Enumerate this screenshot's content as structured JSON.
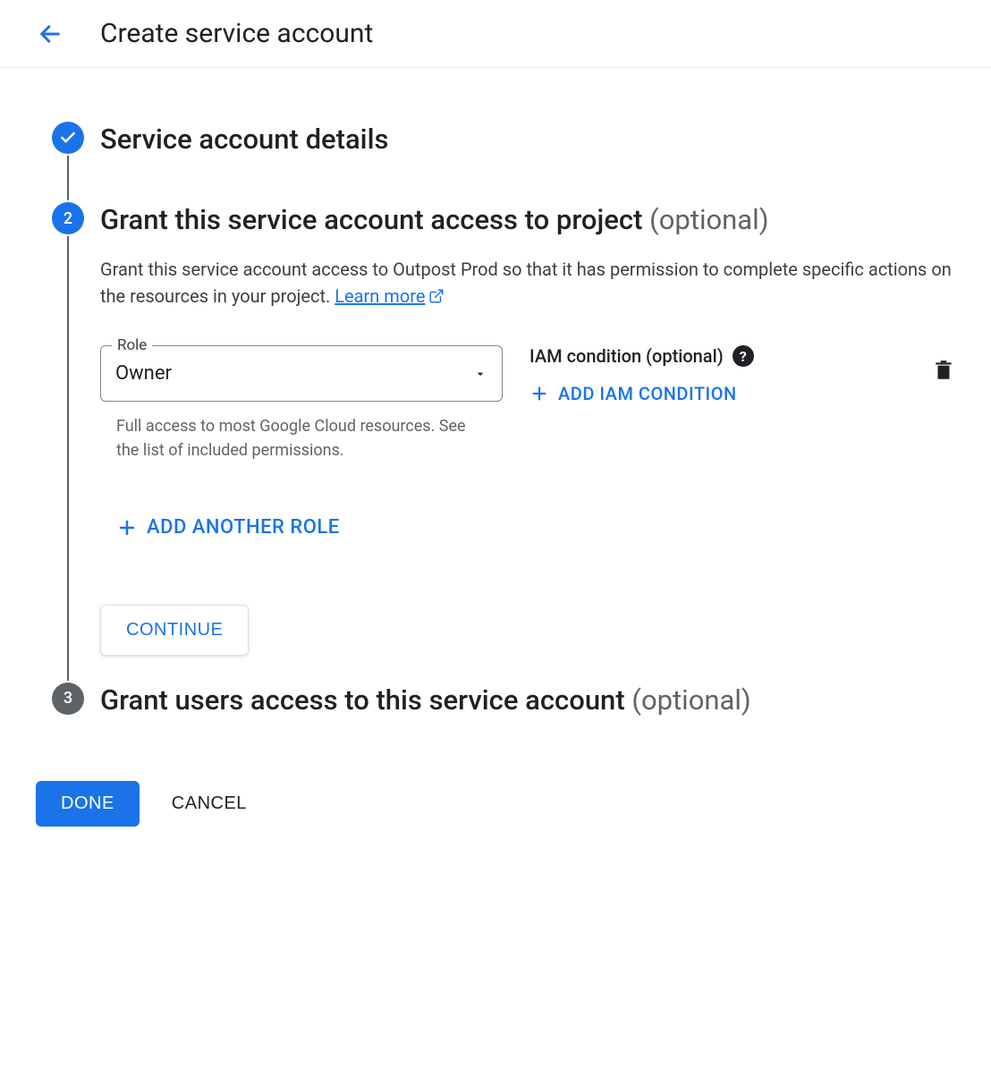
{
  "header": {
    "title": "Create service account"
  },
  "steps": {
    "s1": {
      "title": "Service account details"
    },
    "s2": {
      "number": "2",
      "title": "Grant this service account access to project",
      "optional": "(optional)",
      "description": "Grant this service account access to Outpost Prod so that it has permission to complete specific actions on the resources in your project. ",
      "learn_more": "Learn more",
      "role": {
        "label": "Role",
        "value": "Owner",
        "helper": "Full access to most Google Cloud resources. See the list of included permissions."
      },
      "iam": {
        "label": "IAM condition (optional)",
        "add_label": "ADD IAM CONDITION"
      },
      "add_role_label": "ADD ANOTHER ROLE",
      "continue_label": "CONTINUE"
    },
    "s3": {
      "number": "3",
      "title": "Grant users access to this service account ",
      "optional": "(optional)"
    }
  },
  "actions": {
    "done": "DONE",
    "cancel": "CANCEL"
  }
}
